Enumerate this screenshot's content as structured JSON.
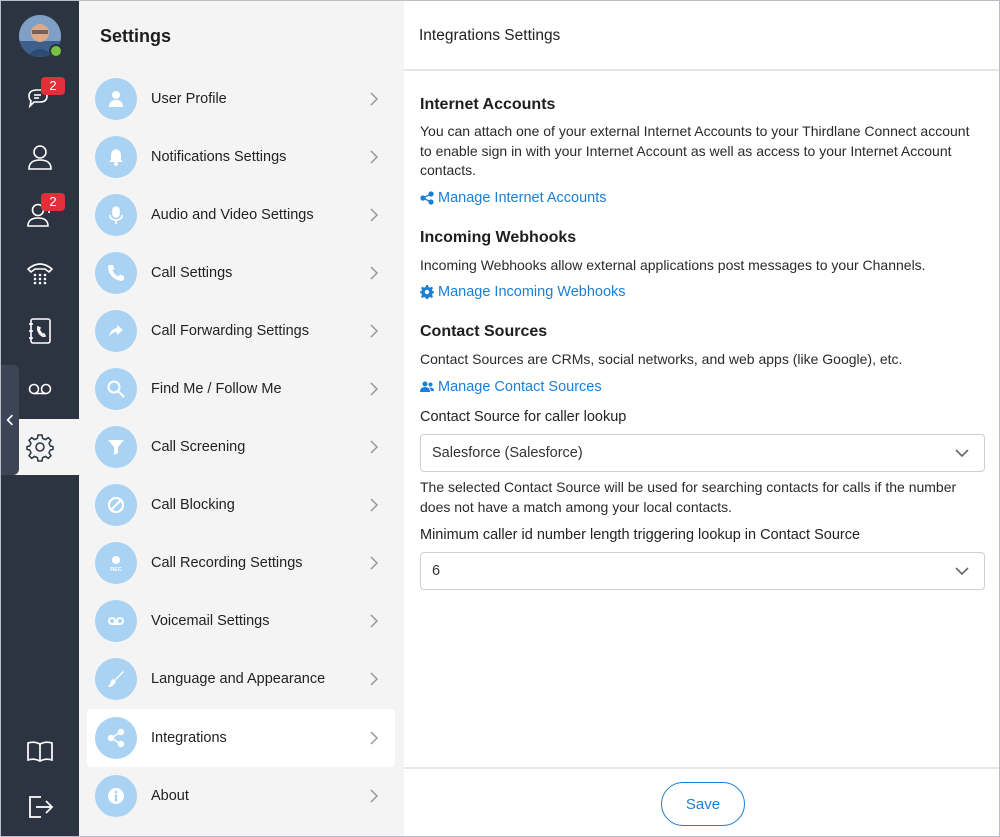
{
  "rail": {
    "chat_badge": "2",
    "contacts_badge": "2"
  },
  "menu": {
    "title": "Settings",
    "items": [
      {
        "label": "User Profile",
        "icon": "user-icon"
      },
      {
        "label": "Notifications Settings",
        "icon": "bell-icon"
      },
      {
        "label": "Audio and Video Settings",
        "icon": "microphone-icon"
      },
      {
        "label": "Call Settings",
        "icon": "phone-icon"
      },
      {
        "label": "Call Forwarding Settings",
        "icon": "forward-arrow-icon"
      },
      {
        "label": "Find Me / Follow Me",
        "icon": "magnifier-icon"
      },
      {
        "label": "Call Screening",
        "icon": "funnel-icon"
      },
      {
        "label": "Call Blocking",
        "icon": "block-icon"
      },
      {
        "label": "Call Recording Settings",
        "icon": "rec-icon",
        "icon_text": "REC"
      },
      {
        "label": "Voicemail Settings",
        "icon": "voicemail-icon"
      },
      {
        "label": "Language and Appearance",
        "icon": "brush-icon"
      },
      {
        "label": "Integrations",
        "icon": "share-icon"
      },
      {
        "label": "About",
        "icon": "info-icon"
      }
    ]
  },
  "content": {
    "title": "Integrations Settings",
    "internet_accounts": {
      "heading": "Internet Accounts",
      "description": "You can attach one of your external Internet Accounts to your Thirdlane Connect account to enable sign in with your Internet Account as well as access to your Internet Account contacts.",
      "link": "Manage Internet Accounts"
    },
    "webhooks": {
      "heading": "Incoming Webhooks",
      "description": "Incoming Webhooks allow external applications post messages to your Channels.",
      "link": "Manage Incoming Webhooks"
    },
    "contact_sources": {
      "heading": "Contact Sources",
      "description": "Contact Sources are CRMs, social networks, and web apps (like Google), etc.",
      "link": "Manage Contact Sources",
      "lookup_label": "Contact Source for caller lookup",
      "lookup_value": "Salesforce (Salesforce)",
      "lookup_help": "The selected Contact Source will be used for searching contacts for calls if the number does not have a match among your local contacts.",
      "min_length_label": "Minimum caller id number length triggering lookup in Contact Source",
      "min_length_value": "6"
    },
    "save_label": "Save"
  },
  "colors": {
    "rail_bg": "#2c3442",
    "menu_bg": "#f4f4f4",
    "icon_bg": "#a9d2f3",
    "link": "#1a7fd6",
    "badge": "#e0313b",
    "presence": "#7ac143"
  }
}
